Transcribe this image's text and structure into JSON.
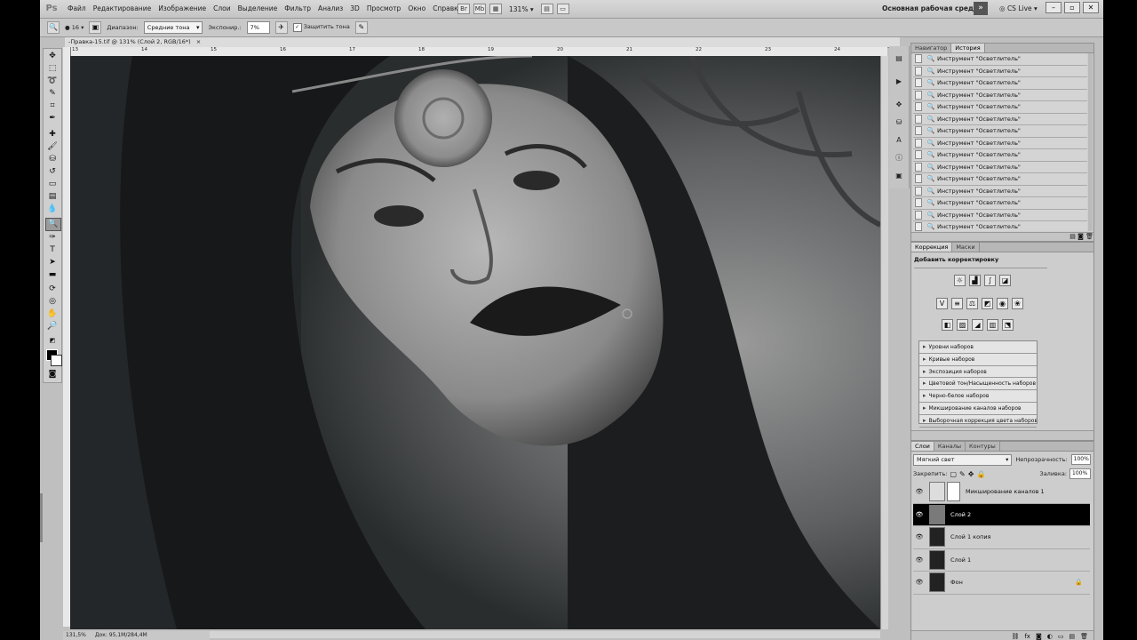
{
  "menubar": {
    "logo": "Ps",
    "items": [
      "Файл",
      "Редактирование",
      "Изображение",
      "Слои",
      "Выделение",
      "Фильтр",
      "Анализ",
      "3D",
      "Просмотр",
      "Окно",
      "Справка"
    ],
    "zoom": "131%",
    "workspace": "Основная рабочая среда",
    "cs_live": "CS Live"
  },
  "options": {
    "brush_size": "16",
    "range_label": "Диапазон:",
    "range_value": "Средние тона",
    "exposure_label": "Экспонир.:",
    "exposure_value": "7%",
    "protect_tones": "Защитить тона"
  },
  "document": {
    "tab_title": "-Правка-15.tif @ 131% (Слой 2, RGB/16*)",
    "ruler_top": [
      "13",
      "14",
      "15",
      "16",
      "17",
      "18",
      "19",
      "20",
      "21",
      "22",
      "23",
      "24"
    ],
    "zoom_status": "131,5%",
    "doc_status": "Док: 95,1M/284,4M"
  },
  "history": {
    "tabs": [
      "Навигатор",
      "История"
    ],
    "active_tab": 1,
    "items": [
      "Инструмент \"Осветлитель\"",
      "Инструмент \"Осветлитель\"",
      "Инструмент \"Осветлитель\"",
      "Инструмент \"Осветлитель\"",
      "Инструмент \"Осветлитель\"",
      "Инструмент \"Осветлитель\"",
      "Инструмент \"Осветлитель\"",
      "Инструмент \"Осветлитель\"",
      "Инструмент \"Осветлитель\"",
      "Инструмент \"Осветлитель\"",
      "Инструмент \"Осветлитель\"",
      "Инструмент \"Осветлитель\"",
      "Инструмент \"Осветлитель\"",
      "Инструмент \"Осветлитель\"",
      "Инструмент \"Осветлитель\"",
      "Инструмент \"Осветлитель\""
    ],
    "selected_index": 15
  },
  "adjustments": {
    "tabs": [
      "Коррекция",
      "Маски"
    ],
    "active_tab": 0,
    "title": "Добавить корректировку",
    "presets": [
      "Уровни наборов",
      "Кривые наборов",
      "Экспозиция наборов",
      "Цветовой тон/Насыщенность наборов",
      "Черно-белое наборов",
      "Микширование каналов наборов",
      "Выборочная коррекция цвета наборов"
    ]
  },
  "layers": {
    "tabs": [
      "Слои",
      "Каналы",
      "Контуры"
    ],
    "active_tab": 0,
    "blend_mode": "Мягкий свет",
    "opacity_label": "Непрозрачность:",
    "opacity_value": "100%",
    "lock_label": "Закрепить:",
    "fill_label": "Заливка:",
    "fill_value": "100%",
    "items": [
      {
        "name": "Микширование каналов 1",
        "selected": false,
        "adjustment": true
      },
      {
        "name": "Слой 2",
        "selected": true,
        "adjustment": false
      },
      {
        "name": "Слой 1 копия",
        "selected": false,
        "adjustment": false
      },
      {
        "name": "Слой 1",
        "selected": false,
        "adjustment": false
      },
      {
        "name": "Фон",
        "selected": false,
        "adjustment": false,
        "locked": true
      }
    ]
  },
  "colors": {
    "foreground": "#000000",
    "background": "#ffffff",
    "selection": "#000000"
  }
}
